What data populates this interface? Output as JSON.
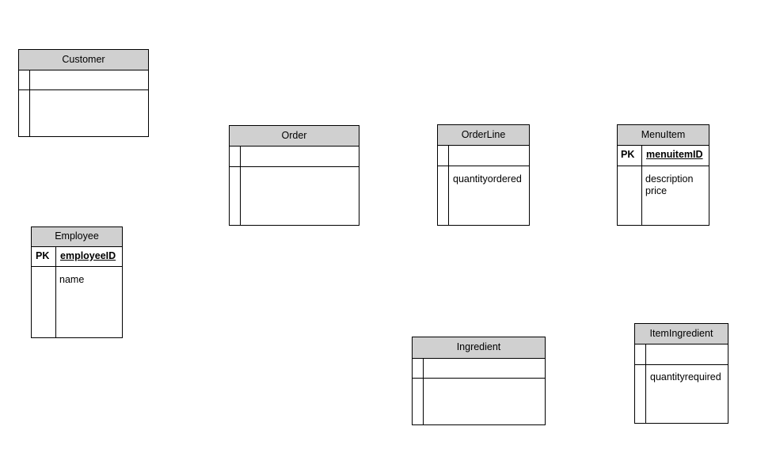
{
  "diagram": {
    "entities": {
      "customer": {
        "name": "Customer",
        "pk_label": "",
        "pk_field": "",
        "attributes": []
      },
      "employee": {
        "name": "Employee",
        "pk_label": "PK",
        "pk_field": "employeeID",
        "attributes": [
          "name"
        ]
      },
      "order": {
        "name": "Order",
        "pk_label": "",
        "pk_field": "",
        "attributes": []
      },
      "orderline": {
        "name": "OrderLine",
        "pk_label": "",
        "pk_field": "",
        "attributes": [
          "quantityordered"
        ]
      },
      "menuitem": {
        "name": "MenuItem",
        "pk_label": "PK",
        "pk_field": "menuitemID",
        "attributes": [
          "description",
          "price"
        ]
      },
      "ingredient": {
        "name": "Ingredient",
        "pk_label": "",
        "pk_field": "",
        "attributes": []
      },
      "itemingredient": {
        "name": "ItemIngredient",
        "pk_label": "",
        "pk_field": "",
        "attributes": [
          "quantityrequired"
        ]
      }
    }
  }
}
